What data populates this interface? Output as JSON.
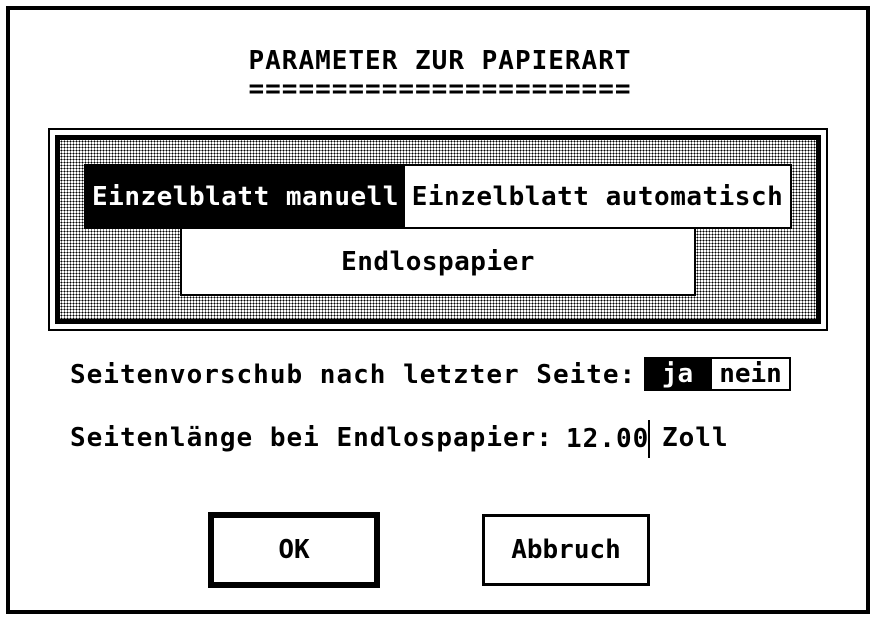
{
  "dialog": {
    "title": "PARAMETER ZUR PAPIERART",
    "title_underline": "======================="
  },
  "paper_type": {
    "options": [
      {
        "label": "Einzelblatt manuell",
        "selected": true
      },
      {
        "label": "Einzelblatt automatisch",
        "selected": false
      },
      {
        "label": "Endlospapier",
        "selected": false
      }
    ]
  },
  "form_feed": {
    "label": "Seitenvorschub nach letzter Seite:",
    "yes_label": "ja",
    "no_label": "nein",
    "selected": "ja"
  },
  "page_length": {
    "label": "Seitenlänge bei Endlospapier:",
    "value": "12.00",
    "unit": "Zoll"
  },
  "buttons": {
    "ok_label": "OK",
    "cancel_label": "Abbruch"
  }
}
